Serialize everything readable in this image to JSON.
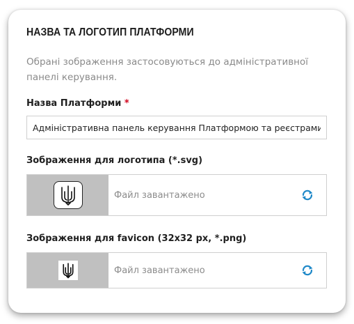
{
  "section": {
    "title": "НАЗВА ТА ЛОГОТИП ПЛАТФОРМИ",
    "description": "Обрані зображення застосовуються до адміністративної панелі керування."
  },
  "platform_name": {
    "label": "Назва Платформи",
    "required_mark": "*",
    "value": "Адміністративна панель керування Платформою та реєстрами"
  },
  "logo": {
    "label": "Зображення для логотипа (*.svg)",
    "status": "Файл завантажено",
    "icon": "trident-icon",
    "refresh_icon": "refresh-icon"
  },
  "favicon": {
    "label": "Зображення для favicon (32x32 px, *.png)",
    "status": "Файл завантажено",
    "icon": "trident-icon",
    "refresh_icon": "refresh-icon"
  },
  "colors": {
    "accent": "#1e88c8",
    "thumb_bg": "#c0c0c0",
    "required": "#d0021b"
  }
}
